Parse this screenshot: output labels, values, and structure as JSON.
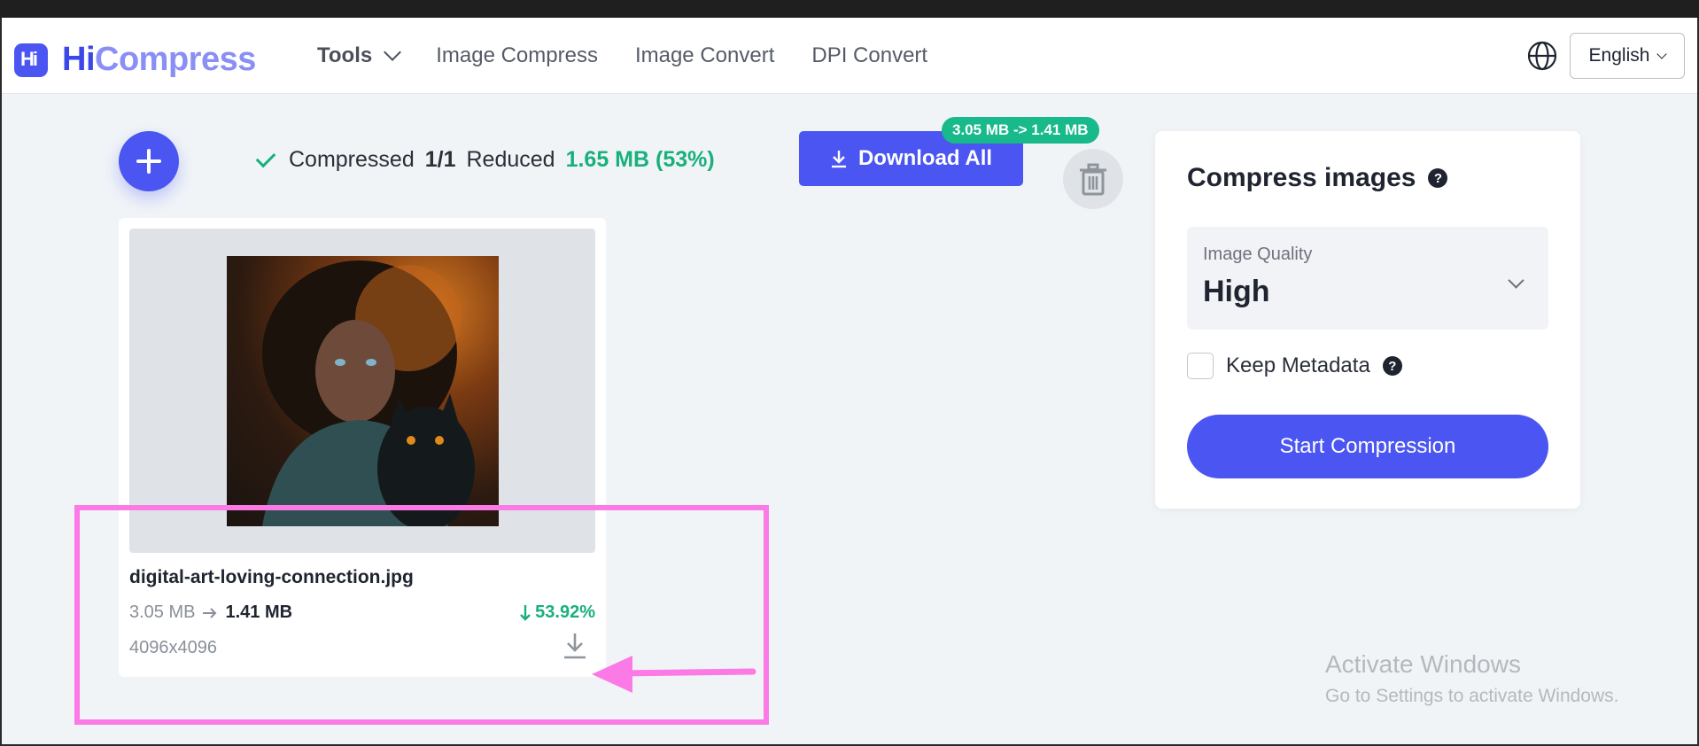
{
  "header": {
    "brand_prefix": "Hi",
    "brand_suffix": "Compress",
    "logo_glyph": "Hi",
    "nav": {
      "tools": "Tools",
      "image_compress": "Image Compress",
      "image_convert": "Image Convert",
      "dpi_convert": "DPI Convert"
    },
    "language": "English"
  },
  "toolbar": {
    "compressed_label": "Compressed",
    "compressed_count": "1/1",
    "reduced_label": "Reduced",
    "reduced_value": "1.65 MB (53%)",
    "download_all": "Download All",
    "size_pill": "3.05 MB -> 1.41 MB"
  },
  "file": {
    "name": "digital-art-loving-connection.jpg",
    "original_size": "3.05 MB",
    "compressed_size": "1.41 MB",
    "reduction": "53.92%",
    "dimensions": "4096x4096"
  },
  "panel": {
    "title": "Compress images",
    "quality_label": "Image Quality",
    "quality_value": "High",
    "keep_metadata": "Keep Metadata",
    "start_button": "Start Compression",
    "help_glyph": "?"
  },
  "watermark": {
    "line1": "Activate Windows",
    "line2": "Go to Settings to activate Windows."
  },
  "colors": {
    "accent": "#4a55f2",
    "success": "#18b07b",
    "highlight": "#fb7ae6"
  },
  "icons": [
    "logo-icon",
    "chevron-down-icon",
    "globe-icon",
    "plus-icon",
    "check-icon",
    "download-icon",
    "trash-icon",
    "arrow-right-icon",
    "arrow-down-icon",
    "help-icon"
  ]
}
